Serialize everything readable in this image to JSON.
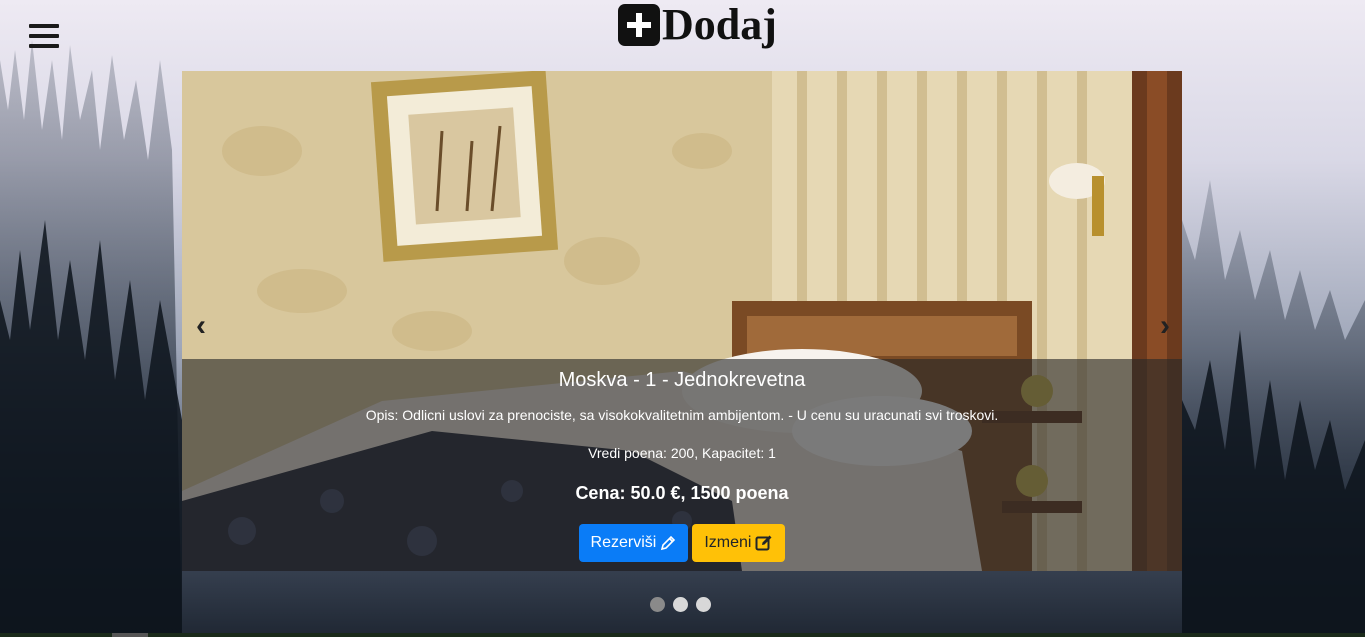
{
  "header": {
    "brand_text": "Dodaj",
    "menu_icon": "hamburger-menu-icon",
    "brand_icon": "plus-square-icon"
  },
  "carousel": {
    "prev_glyph": "‹",
    "next_glyph": "›",
    "slide": {
      "title": "Moskva - 1 - Jednokrevetna",
      "description": "Opis: Odlicni uslovi za prenociste, sa visokokvalitetnim ambijentom. - U cenu su uracunati svi troskovi.",
      "meta": "Vredi poena: 200, Kapacitet: 1",
      "price": "Cena: 50.0 €, 1500 poena",
      "reserve_label": "Rezerviši",
      "edit_label": "Izmeni"
    },
    "indicators": 3,
    "active_indicator": 0
  },
  "colors": {
    "primary": "#0a7cf7",
    "warning": "#ffc107"
  }
}
